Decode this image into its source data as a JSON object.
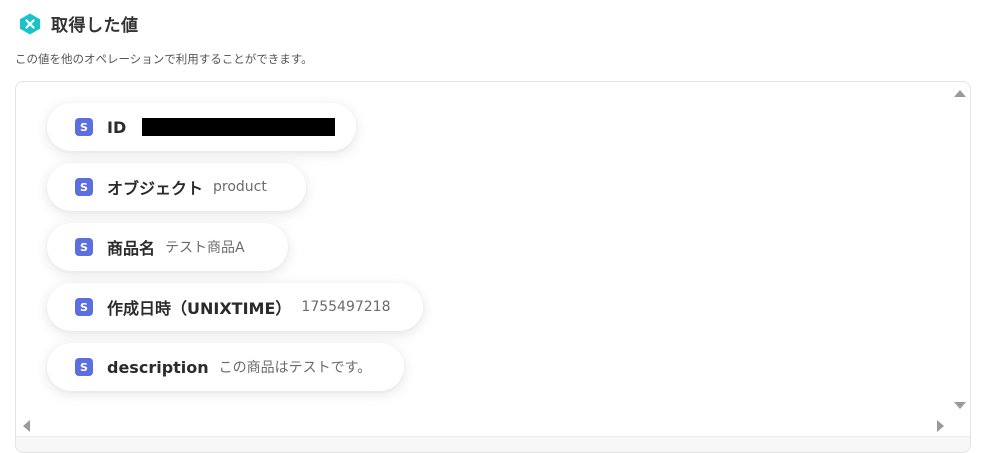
{
  "header": {
    "title": "取得した値",
    "icon": "yoom-x-hexagon-icon",
    "icon_color": "#1cc2c9"
  },
  "subtitle": "この値を他のオペレーションで利用することができます。",
  "badge_letter": "S",
  "badge_color": "#5b6fe0",
  "fields": [
    {
      "label": "ID",
      "value": "",
      "redacted": true
    },
    {
      "label": "オブジェクト",
      "value": "product"
    },
    {
      "label": "商品名",
      "value": "テスト商品A"
    },
    {
      "label": "作成日時（UNIXTIME）",
      "value": "1755497218"
    },
    {
      "label": "description",
      "value": "この商品はテストです。"
    }
  ]
}
